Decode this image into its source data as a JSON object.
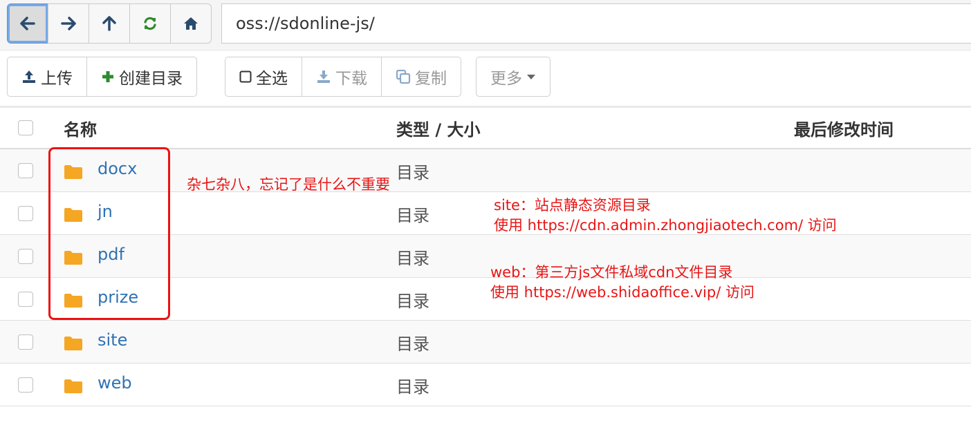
{
  "address_bar": {
    "path": "oss://sdonline-js/"
  },
  "nav_buttons": [
    "back",
    "forward",
    "up",
    "refresh",
    "home"
  ],
  "toolbar": {
    "upload_label": "上传",
    "create_dir_label": "创建目录",
    "select_all_label": "全选",
    "download_label": "下载",
    "copy_label": "复制",
    "more_label": "更多"
  },
  "table": {
    "headers": {
      "name": "名称",
      "type_size": "类型 / 大小",
      "modified": "最后修改时间"
    },
    "rows": [
      {
        "name": "docx",
        "type": "目录"
      },
      {
        "name": "jn",
        "type": "目录"
      },
      {
        "name": "pdf",
        "type": "目录"
      },
      {
        "name": "prize",
        "type": "目录"
      },
      {
        "name": "site",
        "type": "目录"
      },
      {
        "name": "web",
        "type": "目录"
      }
    ]
  },
  "annotations": {
    "misc_note": "杂七杂八，忘记了是什么不重要",
    "site_line1": "site：站点静态资源目录",
    "site_line2": "使用 https://cdn.admin.zhongjiaotech.com/ 访问",
    "web_line1": "web：第三方js文件私域cdn文件目录",
    "web_line2": "使用 https://web.shidaoffice.vip/ 访问"
  },
  "colors": {
    "accent_blue": "#3072b3",
    "folder_orange": "#f5a623",
    "annotation_red": "#e81515",
    "create_green": "#2e8b2e"
  }
}
